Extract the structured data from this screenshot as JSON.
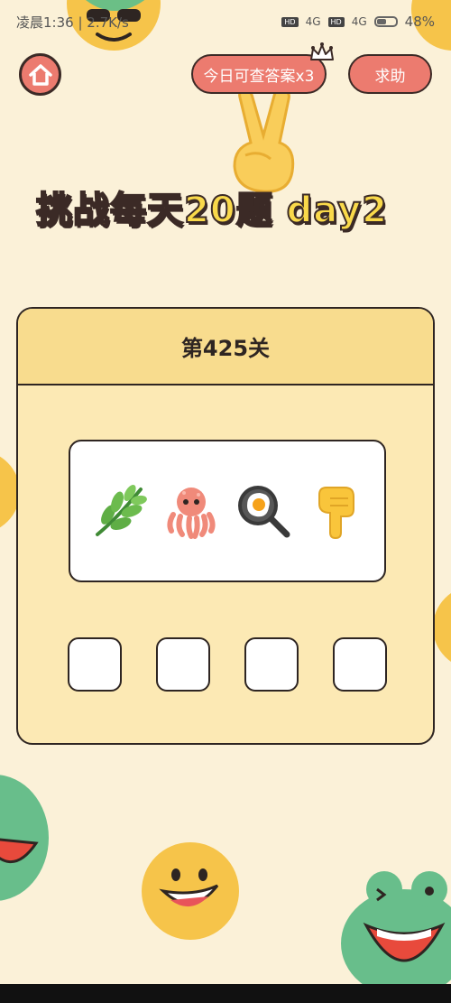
{
  "status_bar": {
    "time": "凌晨1:36",
    "speed": "2.7K/s",
    "hd1": "HD",
    "net1": "4G",
    "hd2": "HD",
    "net2": "4G",
    "battery": "48%"
  },
  "top": {
    "answers_label": "今日可查答案x3",
    "help_label": "求助"
  },
  "title": "挑战每天20题 day2",
  "card": {
    "level_label": "第425关",
    "emojis": [
      "herb-icon",
      "octopus-icon",
      "frying-pan-egg-icon",
      "pointing-down-icon"
    ],
    "slot_count": 4
  },
  "colors": {
    "background": "#fbf1d8",
    "accent": "#ec7b6f",
    "title_yellow": "#f9d94a",
    "card_bg": "#fce9b4",
    "card_header": "#f8dc8e"
  }
}
